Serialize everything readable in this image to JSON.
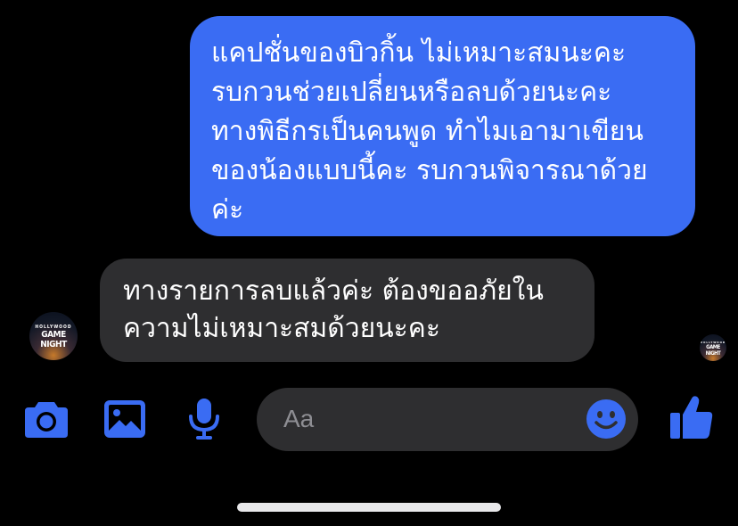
{
  "conversation": {
    "outgoing_message": {
      "lines": [
        "แคปชั่นของบิวกิ้น ไม่เหมาะสมนะคะ",
        "รบกวนช่วยเปลี่ยนหรือลบด้วยนะคะ",
        "ทางพิธีกรเป็นคนพูด ทำไมเอามาเขียน",
        "ของน้องแบบนี้คะ รบกวนพิจารณาด้วย",
        "ค่ะ"
      ],
      "bubble_color": "#3a6cf3"
    },
    "incoming_message": {
      "lines": [
        "ทางรายการลบแล้วค่ะ ต้องขออภัยใน",
        "ความไม่เหมาะสมด้วยนะคะ"
      ],
      "bubble_color": "#2e2e30"
    },
    "sender_avatar": {
      "text_top": "HOLLYWOOD",
      "text_main": "GAME NIGHT"
    }
  },
  "composer": {
    "placeholder": "Aa",
    "icons": [
      "camera-icon",
      "gallery-icon",
      "microphone-icon",
      "emoji-icon",
      "thumbs-up-icon"
    ],
    "accent_color": "#3a6cf3"
  }
}
